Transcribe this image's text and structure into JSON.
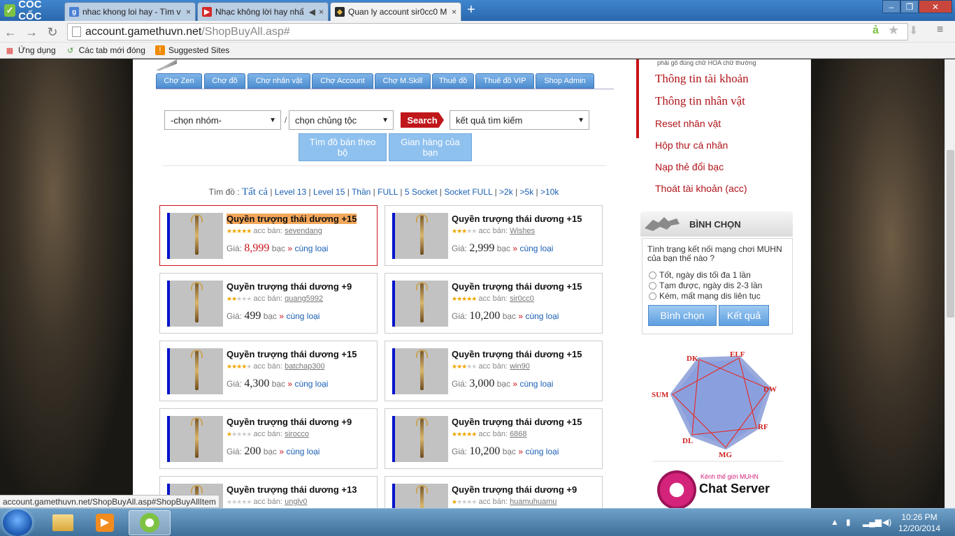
{
  "browser": {
    "logo": "CỐC CỐC",
    "tabs": [
      {
        "title": "nhac khong loi hay - Tìm v",
        "icon": "google-icon",
        "active": false
      },
      {
        "title": "Nhạc không lời hay nhấ",
        "icon": "youtube-icon",
        "active": false
      },
      {
        "title": "Quan ly account sir0cc0 M",
        "icon": "game-icon",
        "active": true
      }
    ],
    "url_domain": "account.gamethuvn.net",
    "url_path": "/ShopBuyAll.asp#",
    "bookmarks": [
      {
        "label": "Ứng dụng",
        "icon": "apps-icon"
      },
      {
        "label": "Các tab mới đóng",
        "icon": "recent-tabs-icon"
      },
      {
        "label": "Suggested Sites",
        "icon": "suggested-sites-icon"
      }
    ],
    "status_url": "account.gamethuvn.net/ShopBuyAll.asp#ShopBuyAllItem"
  },
  "shop": {
    "menu": [
      "Chợ Zen",
      "Chợ đồ",
      "Chợ nhân vật",
      "Chợ Account",
      "Chợ M.Skill",
      "Thuê đồ",
      "Thuê đồ VIP",
      "Shop Admin"
    ],
    "group_select": "-chọn nhóm-",
    "race_select": "chọn chủng tộc",
    "search_label": "Search",
    "result_select": "kết quả tìm kiếm",
    "btn_find_set": "Tìm đồ bán theo bộ",
    "btn_my_shop": "Gian hàng của bạn",
    "filter_prefix": "Tìm đồ :",
    "filter_all": "Tất cả",
    "filters": [
      "Level 13",
      "Level 15",
      "Thần",
      "FULL",
      "5 Socket",
      "Socket FULL",
      ">2k",
      ">5k",
      ">10k"
    ],
    "seller_label": "acc bán:",
    "price_label": "Giá:",
    "currency": "bạc",
    "same_type": "cùng loại",
    "items": [
      {
        "name": "Quyền trượng thái dương +15",
        "stars": 5,
        "seller": "sevendang",
        "price": "8,999",
        "highlight": true
      },
      {
        "name": "Quyền trượng thái dương +15",
        "stars": 3,
        "seller": "Wishes",
        "price": "2,999",
        "highlight": false
      },
      {
        "name": "Quyền trượng thái dương +9",
        "stars": 2,
        "seller": "quang5992",
        "price": "499",
        "highlight": false
      },
      {
        "name": "Quyền trượng thái dương +15",
        "stars": 5,
        "seller": "sir0cc0",
        "price": "10,200",
        "highlight": false
      },
      {
        "name": "Quyền trượng thái dương +15",
        "stars": 4,
        "seller": "batchap300",
        "price": "4,300",
        "highlight": false
      },
      {
        "name": "Quyền trượng thái dương +15",
        "stars": 3,
        "seller": "win90",
        "price": "3,000",
        "highlight": false
      },
      {
        "name": "Quyền trượng thái dương +9",
        "stars": 1,
        "seller": "sirocco",
        "price": "200",
        "highlight": false
      },
      {
        "name": "Quyền trượng thái dương +15",
        "stars": 5,
        "seller": "6868",
        "price": "10,200",
        "highlight": false
      },
      {
        "name": "Quyền trượng thái dương +13",
        "stars": 0,
        "seller": "unglv0",
        "price": "",
        "highlight": false
      },
      {
        "name": "Quyền trượng thái dương +9",
        "stars": 1,
        "seller": "huamuhuamu",
        "price": "",
        "highlight": false
      }
    ]
  },
  "sidebar": {
    "note": "phải gõ đúng chữ HOA chữ thường",
    "links": [
      {
        "label": "Thông tin tài khoản",
        "big": true
      },
      {
        "label": "Thông tin nhân vật",
        "big": true
      },
      {
        "label": "Reset nhân vật",
        "big": false
      },
      {
        "label": "Hộp thư cá nhân",
        "big": false
      },
      {
        "label": "Nạp thẻ đổi bạc",
        "big": false
      },
      {
        "label": "Thoát tài khoản (acc)",
        "big": false
      }
    ],
    "poll_title": "BÌNH CHỌN",
    "poll_question": "Tình trạng kết nối mạng chơi MUHN của bạn thế nào ?",
    "poll_options": [
      "Tốt, ngày dis tối đa 1 lần",
      "Tạm được, ngày dis 2-3 lần",
      "Kém, mất mạng dis liên tục"
    ],
    "vote_btn": "Bình chọn",
    "result_btn": "Kết quả",
    "classes": [
      "DK",
      "ELF",
      "DW",
      "RF",
      "MG",
      "DL",
      "SUM"
    ],
    "chat_sub": "Kênh thế giới MUHN",
    "chat_title": "Chat Server"
  },
  "taskbar": {
    "time": "10:26 PM",
    "date": "12/20/2014"
  },
  "colors": {
    "accent_red": "#c8141a",
    "link_blue": "#1a5fb4",
    "tab_blue": "#4d8dd0"
  }
}
